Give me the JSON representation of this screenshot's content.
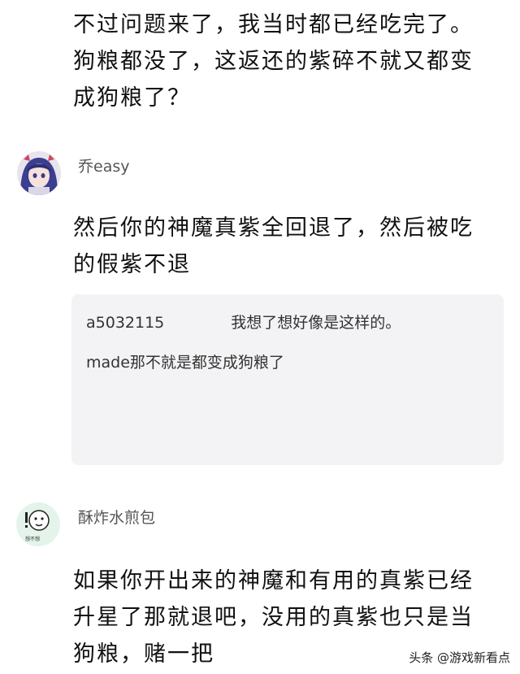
{
  "top_comment": {
    "lines": [
      "不过问题来了，我当时都已经吃完了。",
      "狗粮都没了，这返还的紫碎不就又都变",
      "成狗粮了？"
    ]
  },
  "comment1": {
    "username": "乔easy",
    "avatar_icon": "anime-girl-avatar",
    "lines": [
      "然后你的神魔真紫全回退了，然后被吃",
      "的假紫不退"
    ],
    "quote": {
      "author": "a5032115",
      "line1": "我想了想好像是这样的。",
      "line2": "made那不就是都变成狗粮了"
    }
  },
  "comment2": {
    "username": "酥炸水煎包",
    "avatar_icon": "meme-face-avatar",
    "avatar_caption": "想不想",
    "lines": [
      "如果你开出来的神魔和有用的真紫已经",
      "升星了那就退吧，没用的真紫也只是当",
      "狗粮，赌一把"
    ]
  },
  "watermark": "头条 @游戏新看点",
  "colors": {
    "quote_bg": "#f3f3f5",
    "text": "#111111",
    "username": "#555555"
  }
}
